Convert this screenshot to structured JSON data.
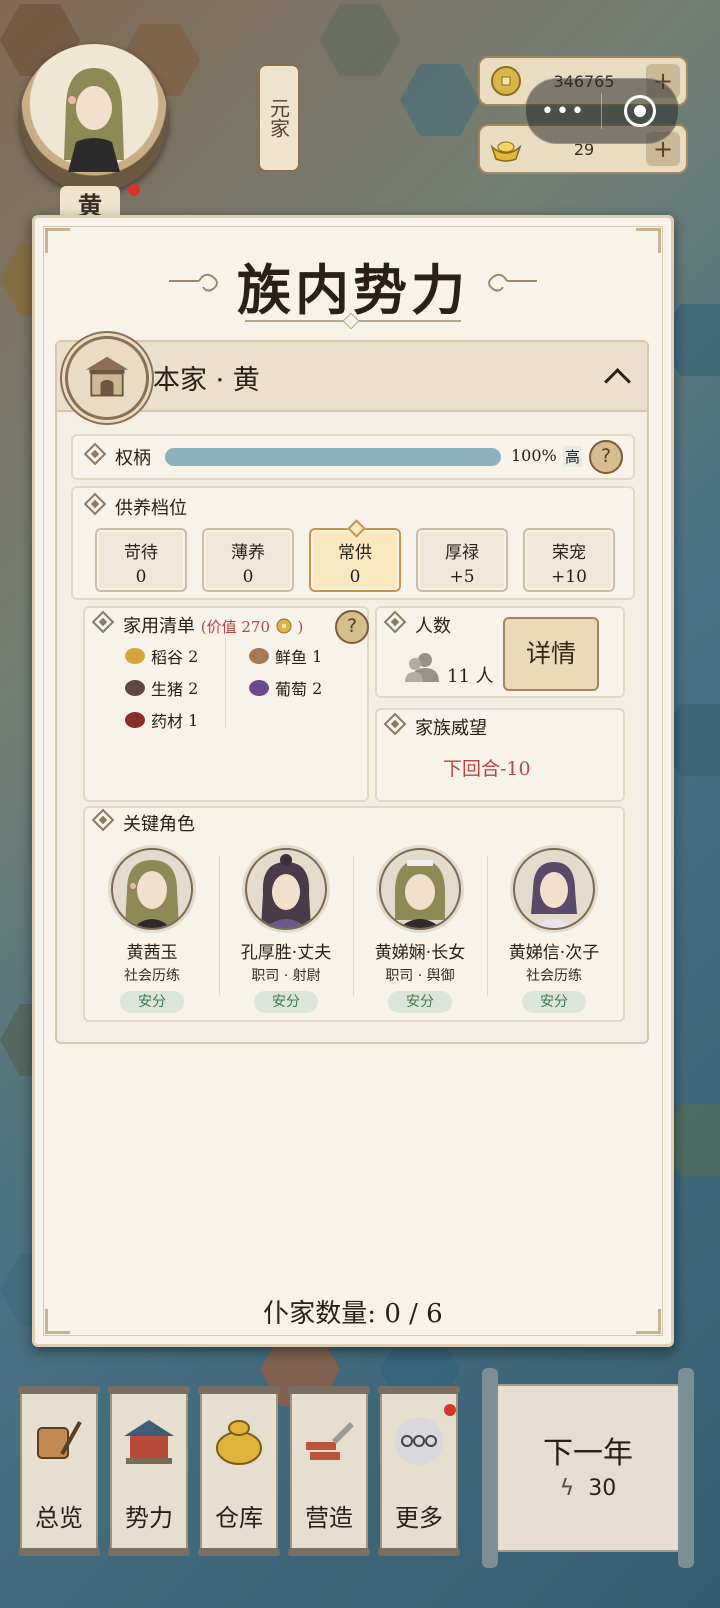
{
  "hud": {
    "clan_tab": "元家",
    "player_surname": "黄",
    "coins": "346765",
    "gold": "29",
    "plus": "+",
    "capsule_menu": "•••"
  },
  "panel": {
    "title": "族内势力",
    "section_title": "本家 · 黄",
    "power": {
      "label": "权柄",
      "percent_text": "100%",
      "level": "高",
      "fill": 1.0
    },
    "help": "?",
    "support": {
      "label": "供养档位",
      "tiers": [
        {
          "name": "苛待",
          "value": "0"
        },
        {
          "name": "薄养",
          "value": "0"
        },
        {
          "name": "常供",
          "value": "0",
          "selected": true
        },
        {
          "name": "厚禄",
          "value": "+5"
        },
        {
          "name": "荣宠",
          "value": "+10"
        }
      ]
    },
    "household": {
      "label": "家用清单",
      "value_prefix": "(价值 270",
      "value_suffix": ")",
      "items": [
        {
          "name": "稻谷",
          "qty": "2",
          "icon": "rice-icon"
        },
        {
          "name": "鲜鱼",
          "qty": "1",
          "icon": "fish-icon"
        },
        {
          "name": "生猪",
          "qty": "2",
          "icon": "pig-icon"
        },
        {
          "name": "葡萄",
          "qty": "2",
          "icon": "grape-icon"
        },
        {
          "name": "药材",
          "qty": "1",
          "icon": "herb-icon"
        }
      ]
    },
    "population": {
      "label": "人数",
      "count": "11 人",
      "detail_button": "详情"
    },
    "prestige": {
      "label": "家族威望",
      "next_turn": "下回合-10"
    },
    "key_roles": {
      "label": "关键角色",
      "characters": [
        {
          "name": "黄茜玉",
          "role": "社会历练",
          "status": "安分"
        },
        {
          "name": "孔厚胜·丈夫",
          "role": "职司 · 射尉",
          "status": "安分"
        },
        {
          "name": "黄娣娴·长女",
          "role": "职司 · 舆御",
          "status": "安分"
        },
        {
          "name": "黄娣信·次子",
          "role": "社会历练",
          "status": "安分"
        }
      ]
    },
    "servant_count": "仆家数量: 0 / 6"
  },
  "bottom_nav": {
    "items": [
      {
        "label": "总览",
        "icon": "brush-icon"
      },
      {
        "label": "势力",
        "icon": "palace-icon"
      },
      {
        "label": "仓库",
        "icon": "money-bag-icon"
      },
      {
        "label": "营造",
        "icon": "trowel-icon"
      },
      {
        "label": "更多",
        "icon": "more-icon"
      }
    ],
    "next_year": {
      "label": "下一年",
      "energy": "30"
    }
  },
  "colors": {
    "accent_red": "#b9463c",
    "status_green": "#3e7a52",
    "progress": "#8fb0bd"
  }
}
